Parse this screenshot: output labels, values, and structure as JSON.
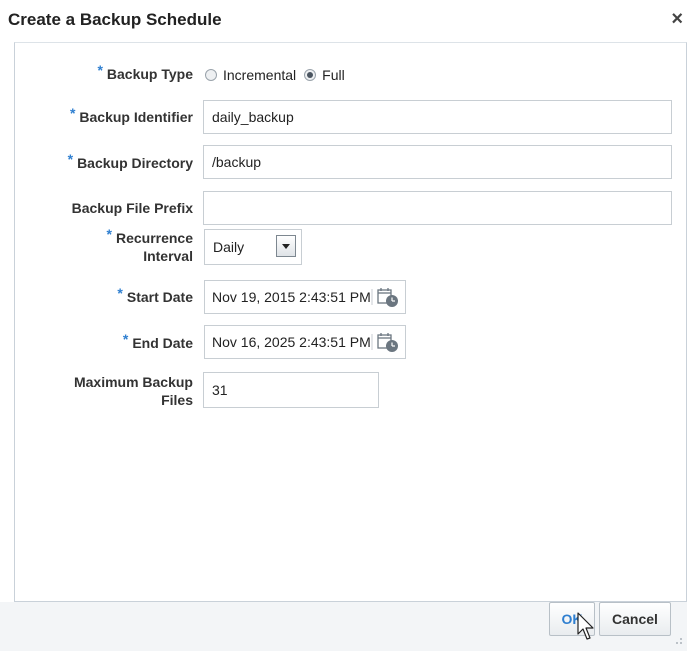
{
  "dialog": {
    "title": "Create a Backup Schedule",
    "close_glyph": "×"
  },
  "form": {
    "required_marker": "*",
    "backup_type": {
      "label": "Backup Type",
      "options": [
        {
          "label": "Incremental",
          "checked": false
        },
        {
          "label": "Full",
          "checked": true
        }
      ]
    },
    "backup_identifier": {
      "label": "Backup Identifier",
      "value": "daily_backup"
    },
    "backup_directory": {
      "label": "Backup Directory",
      "value": "/backup"
    },
    "backup_file_prefix": {
      "label": "Backup File Prefix",
      "value": ""
    },
    "recurrence_interval": {
      "label_line1": "Recurrence",
      "label_line2": "Interval",
      "value": "Daily"
    },
    "start_date": {
      "label": "Start Date",
      "value": "Nov 19, 2015 2:43:51 PM"
    },
    "end_date": {
      "label": "End Date",
      "value": "Nov 16, 2025 2:43:51 PM"
    },
    "maximum_backup_files": {
      "label_line1": "Maximum Backup",
      "label_line2": "Files",
      "value": "31"
    }
  },
  "buttons": {
    "ok": "OK",
    "cancel": "Cancel"
  },
  "icons": {
    "calendar": "calendar-clock-icon",
    "dropdown": "chevron-down-icon",
    "close": "close-icon"
  },
  "colors": {
    "required": "#2f7fd0",
    "ok_text": "#2f7fd0"
  }
}
